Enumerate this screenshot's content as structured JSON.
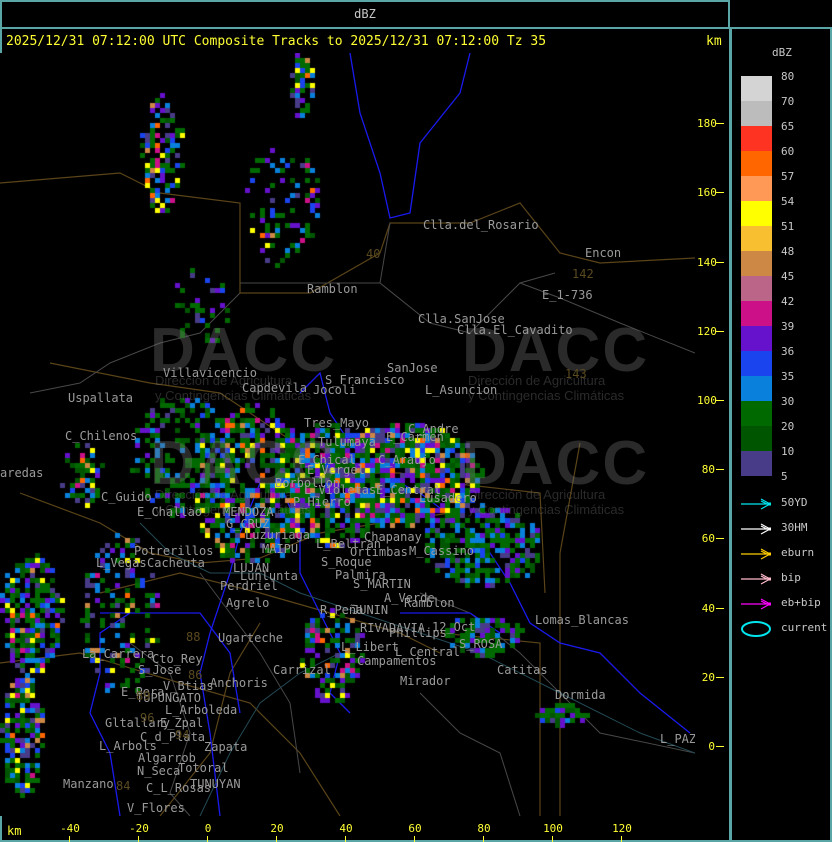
{
  "window_title": "dBZ",
  "header": {
    "line": "2025/12/31 07:12:00 UTC Composite Tracks to 2025/12/31 07:12:00 Tz 35",
    "km_label": "km"
  },
  "axes": {
    "x_unit": "km",
    "x_ticks": [
      "-40",
      "-20",
      "0",
      "20",
      "40",
      "60",
      "80",
      "100",
      "120"
    ],
    "y_ticks": [
      "180",
      "160",
      "140",
      "120",
      "100",
      "80",
      "60",
      "40",
      "20",
      "0"
    ]
  },
  "watermark": {
    "logo": "DACC",
    "line1": "Dirección de Agricultura",
    "line2": "y Contingencias Climáticas"
  },
  "towns": [
    "Clla.del_Rosario",
    "Encon",
    "E_1-736",
    "Ramblon",
    "Clla.SanJose",
    "Clla.El_Cavadito",
    "SanJose",
    "Villavicencio",
    "S_Francisco",
    "L_Asuncion",
    "Capdevila",
    "Uspallata",
    "Jocoli",
    "Tres_Mayo",
    "C_Andre",
    "E_Carmen",
    "C_Chilenos",
    "Tulumaya",
    "E_Chical",
    "C_Araujo",
    "E_Vergel",
    "aredas",
    "Borbollon",
    "L_Violetas",
    "E_Central",
    "Lusadero",
    "P_Hierro",
    "C_Guido",
    "E_Challao",
    "MENDOZA",
    "G_CRUZ",
    "Luzuriaga",
    "Chapanay",
    "L_Beltran",
    "MAIPU",
    "Ortimbas",
    "M_Cassino",
    "Potrerillos",
    "L_Vegas",
    "Cacheuta",
    "S_Roque",
    "LUJAN",
    "Lunlunta",
    "Palmira",
    "S_MARTIN",
    "Perdriel",
    "A_Verde",
    "Ramblon",
    "Agrelo",
    "R_Peña",
    "JUNIN",
    "Ugarteche",
    "RIVADAVIA",
    "Phillips",
    "12_Oct",
    "Lomas_Blancas",
    "S_ROSA",
    "L_Libert",
    "La_Carrera",
    "Cto_Rey",
    "Carrizal",
    "L_Central",
    "Campamentos",
    "S_Jose",
    "Catitas",
    "Anchoris",
    "Mirador",
    "E_Pera",
    "V_Btias",
    "TUPUNGATO",
    "Dormida",
    "L_Arboleda",
    "Gltallary",
    "E_Zpal",
    "C_d_Plata",
    "L_PAZ",
    "L_Arbols",
    "Zapata",
    "Algarrob",
    "N_Seca",
    "Totoral",
    "TUNUYAN",
    "Manzano",
    "C_L_Rosas",
    "V_Flores"
  ],
  "route_numbers": [
    "40",
    "142",
    "143",
    "88",
    "86",
    "89",
    "96",
    "94",
    "84"
  ],
  "legend": {
    "title": "dBZ",
    "levels": [
      "80",
      "70",
      "65",
      "60",
      "57",
      "54",
      "51",
      "48",
      "45",
      "42",
      "39",
      "36",
      "35",
      "30",
      "20",
      "10",
      "5"
    ],
    "colors": [
      "#d4d4d4",
      "#bcbcbc",
      "#ff3322",
      "#ff6600",
      "#ff9955",
      "#ffff00",
      "#f8c030",
      "#cc8844",
      "#bb6688",
      "#cc1188",
      "#6611cc",
      "#1a44ee",
      "#0a80dd",
      "#006a00",
      "#005500",
      "#483c88"
    ],
    "tracks": [
      {
        "label": "50YD",
        "color": "#00e5ee"
      },
      {
        "label": "30HM",
        "color": "#ffffff"
      },
      {
        "label": "eburn",
        "color": "#ffcc00"
      },
      {
        "label": "bip",
        "color": "#ffbbcc"
      },
      {
        "label": "eb+bip",
        "color": "#ff00ff"
      },
      {
        "label": "current",
        "color": "#00e5ee"
      }
    ]
  }
}
